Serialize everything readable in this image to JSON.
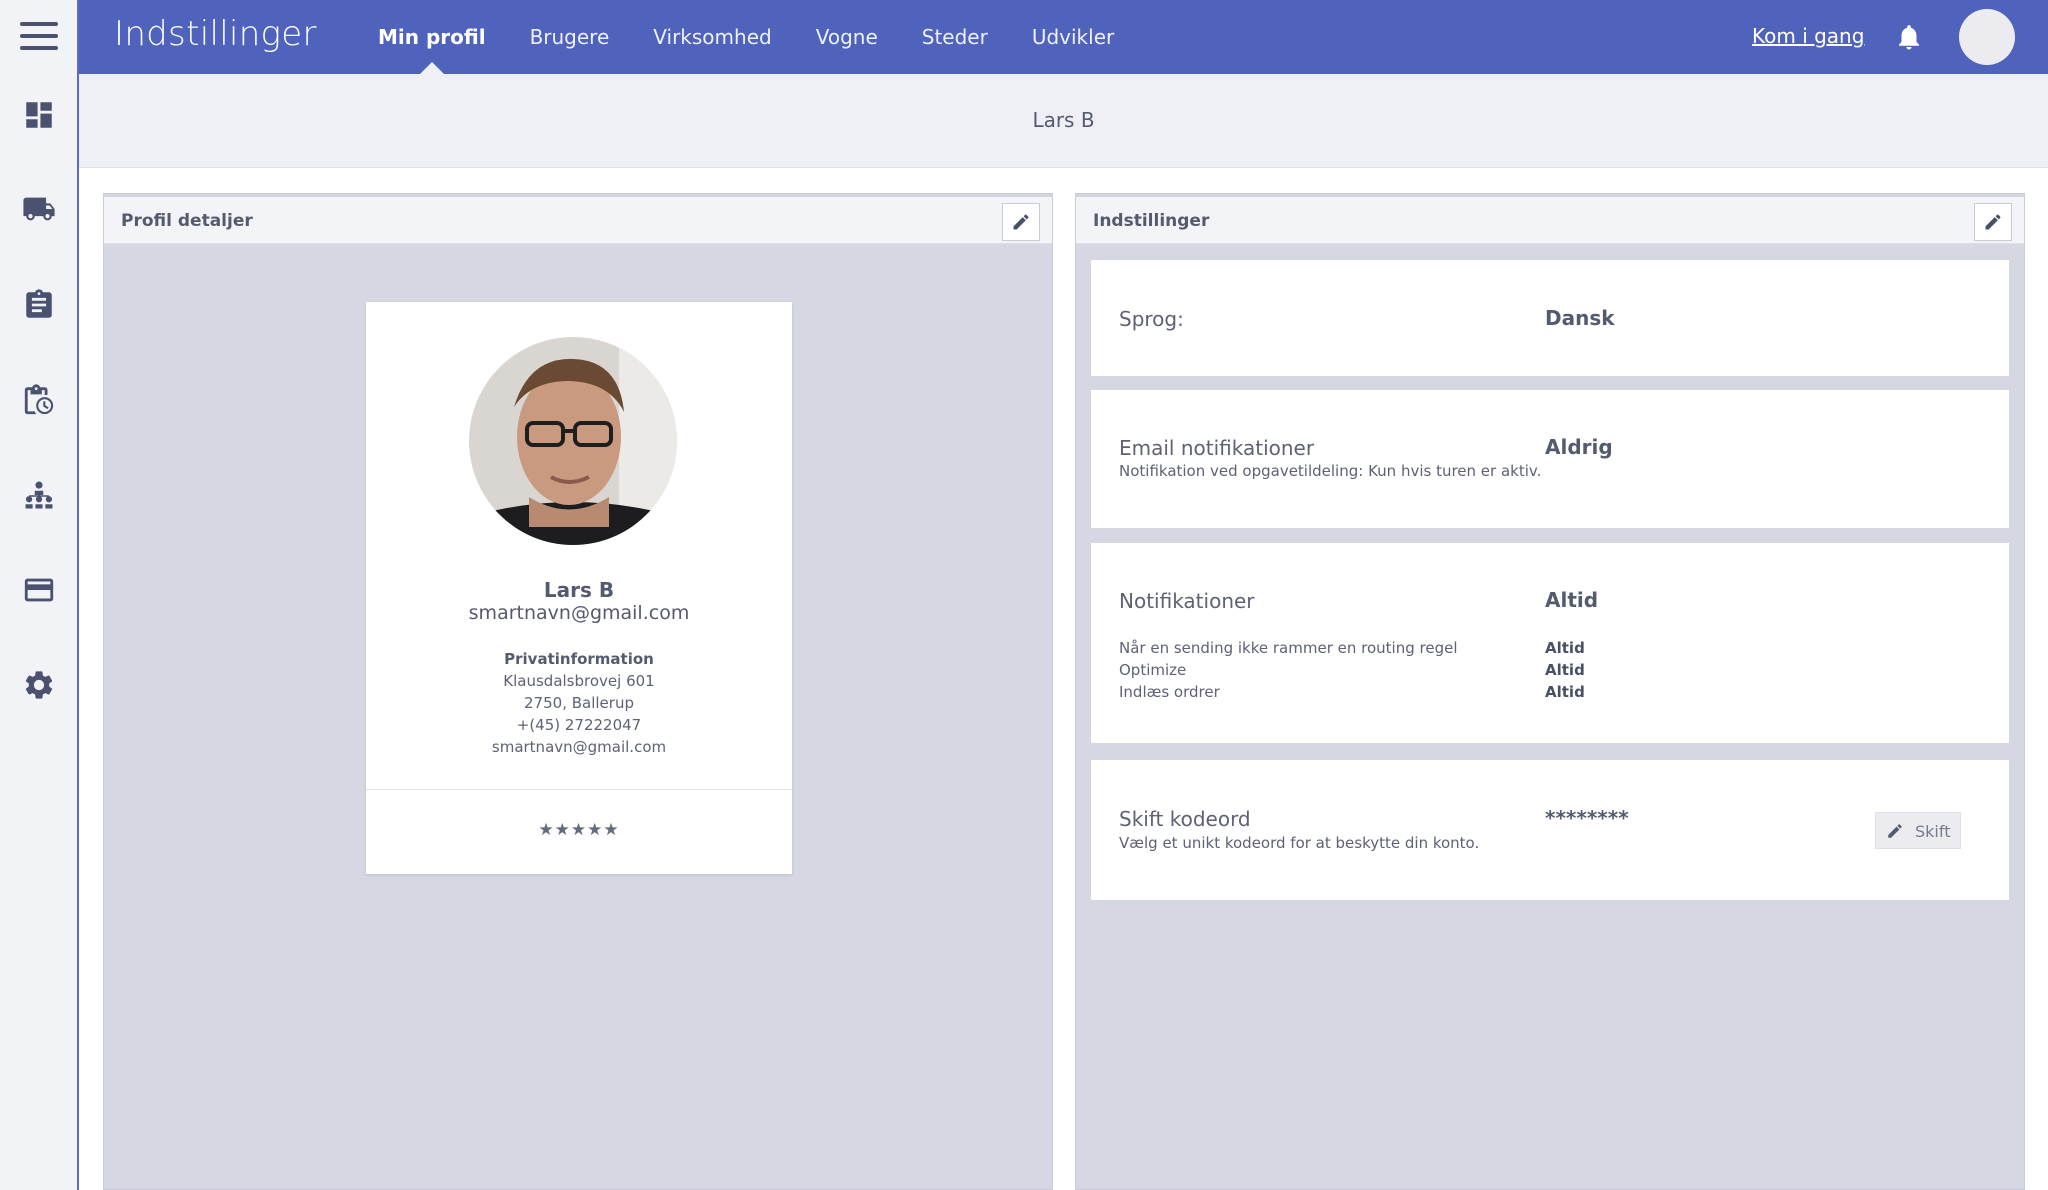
{
  "app": {
    "title": "Indstillinger"
  },
  "nav": [
    {
      "label": "Min profil",
      "active": true
    },
    {
      "label": "Brugere"
    },
    {
      "label": "Virksomhed"
    },
    {
      "label": "Vogne"
    },
    {
      "label": "Steder"
    },
    {
      "label": "Udvikler"
    }
  ],
  "header": {
    "get_started": "Kom i gang"
  },
  "rail_icons": [
    "dashboard-icon",
    "truck-icon",
    "clipboard-icon",
    "clipboard-clock-icon",
    "org-chart-icon",
    "credit-card-icon",
    "gear-icon"
  ],
  "subheader": {
    "user_name": "Lars B"
  },
  "profile_panel": {
    "title": "Profil detaljer",
    "name": "Lars B",
    "email": "smartnavn@gmail.com",
    "private_label": "Privatinformation",
    "address": "Klausdalsbrovej 601",
    "city": "2750, Ballerup",
    "phone": "+(45) 27222047",
    "private_email": "smartnavn@gmail.com",
    "rating_stars": "★★★★★"
  },
  "settings_panel": {
    "title": "Indstillinger",
    "language": {
      "label": "Sprog:",
      "value": "Dansk"
    },
    "email_notifications": {
      "label": "Email notifikationer",
      "value": "Aldrig",
      "description": "Notifikation ved opgavetildeling: Kun hvis turen er aktiv."
    },
    "notifications": {
      "label": "Notifikationer",
      "value": "Altid",
      "items": [
        {
          "label": "Når en sending ikke rammer en routing regel",
          "value": "Altid"
        },
        {
          "label": "Optimize",
          "value": "Altid"
        },
        {
          "label": "Indlæs ordrer",
          "value": "Altid"
        }
      ]
    },
    "password": {
      "label": "Skift kodeord",
      "value": "********",
      "description": "Vælg et unikt kodeord for at beskytte din konto.",
      "button": "Skift"
    }
  },
  "colors": {
    "topbar": "#4f63bd",
    "panel_bg": "#d5d8e2",
    "text": "#555b6e"
  }
}
